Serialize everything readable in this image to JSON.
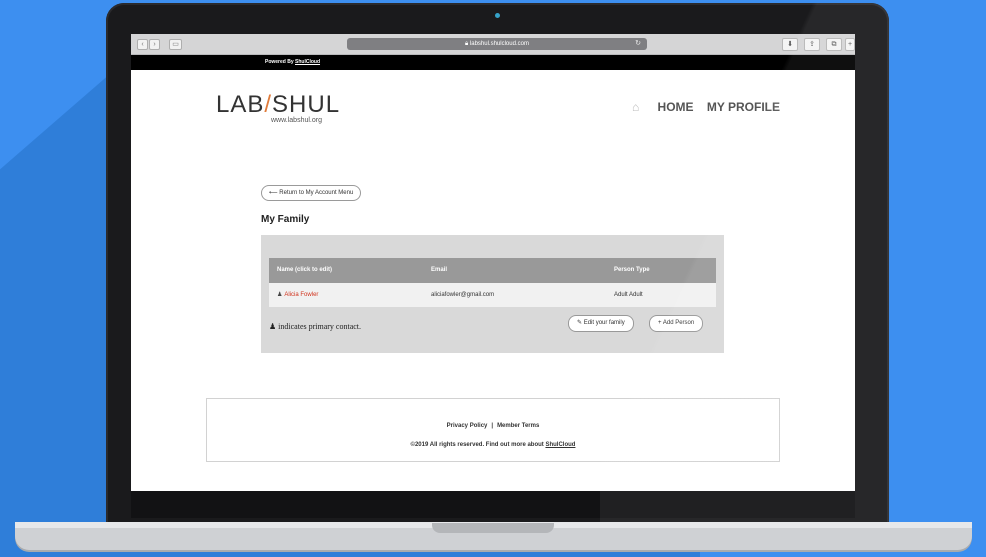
{
  "browser": {
    "url": "labshul.shulcloud.com",
    "lock_icon": "lock-icon",
    "back_icon": "chevron-left-icon",
    "forward_icon": "chevron-right-icon",
    "sidebar_icon": "sidebar-icon",
    "reload_icon": "reload-icon",
    "toolbar_icons": [
      "download-icon",
      "share-icon",
      "tabs-icon",
      "new-tab-icon"
    ]
  },
  "banner": {
    "powered_by": "Powered By",
    "link": "ShulCloud"
  },
  "header": {
    "logo_left": "LAB",
    "logo_slash": "/",
    "logo_right": "SHUL",
    "logo_url": "www.labshul.org",
    "nav": {
      "home_icon": "home-icon",
      "home": "HOME",
      "profile": "MY PROFILE"
    }
  },
  "main": {
    "return_button": "Return to My Account Menu",
    "title": "My Family",
    "table": {
      "columns": [
        "Name (click to edit)",
        "Email",
        "Person Type"
      ],
      "rows": [
        {
          "name": "Alicia Fowler",
          "email": "aliciafowler@gmail.com",
          "type": "Adult Adult"
        }
      ]
    },
    "primary_note": "indicates primary contact.",
    "edit_button": "Edit your family",
    "add_button": "Add Person"
  },
  "footer": {
    "privacy": "Privacy Policy",
    "separator": "|",
    "terms": "Member Terms",
    "copyright": "©2019 All rights reserved. Find out more about",
    "shulcloud": "ShulCloud"
  },
  "colors": {
    "background": "#3d8ff0",
    "accent": "#e07b3a",
    "link_red": "#d0321c"
  }
}
